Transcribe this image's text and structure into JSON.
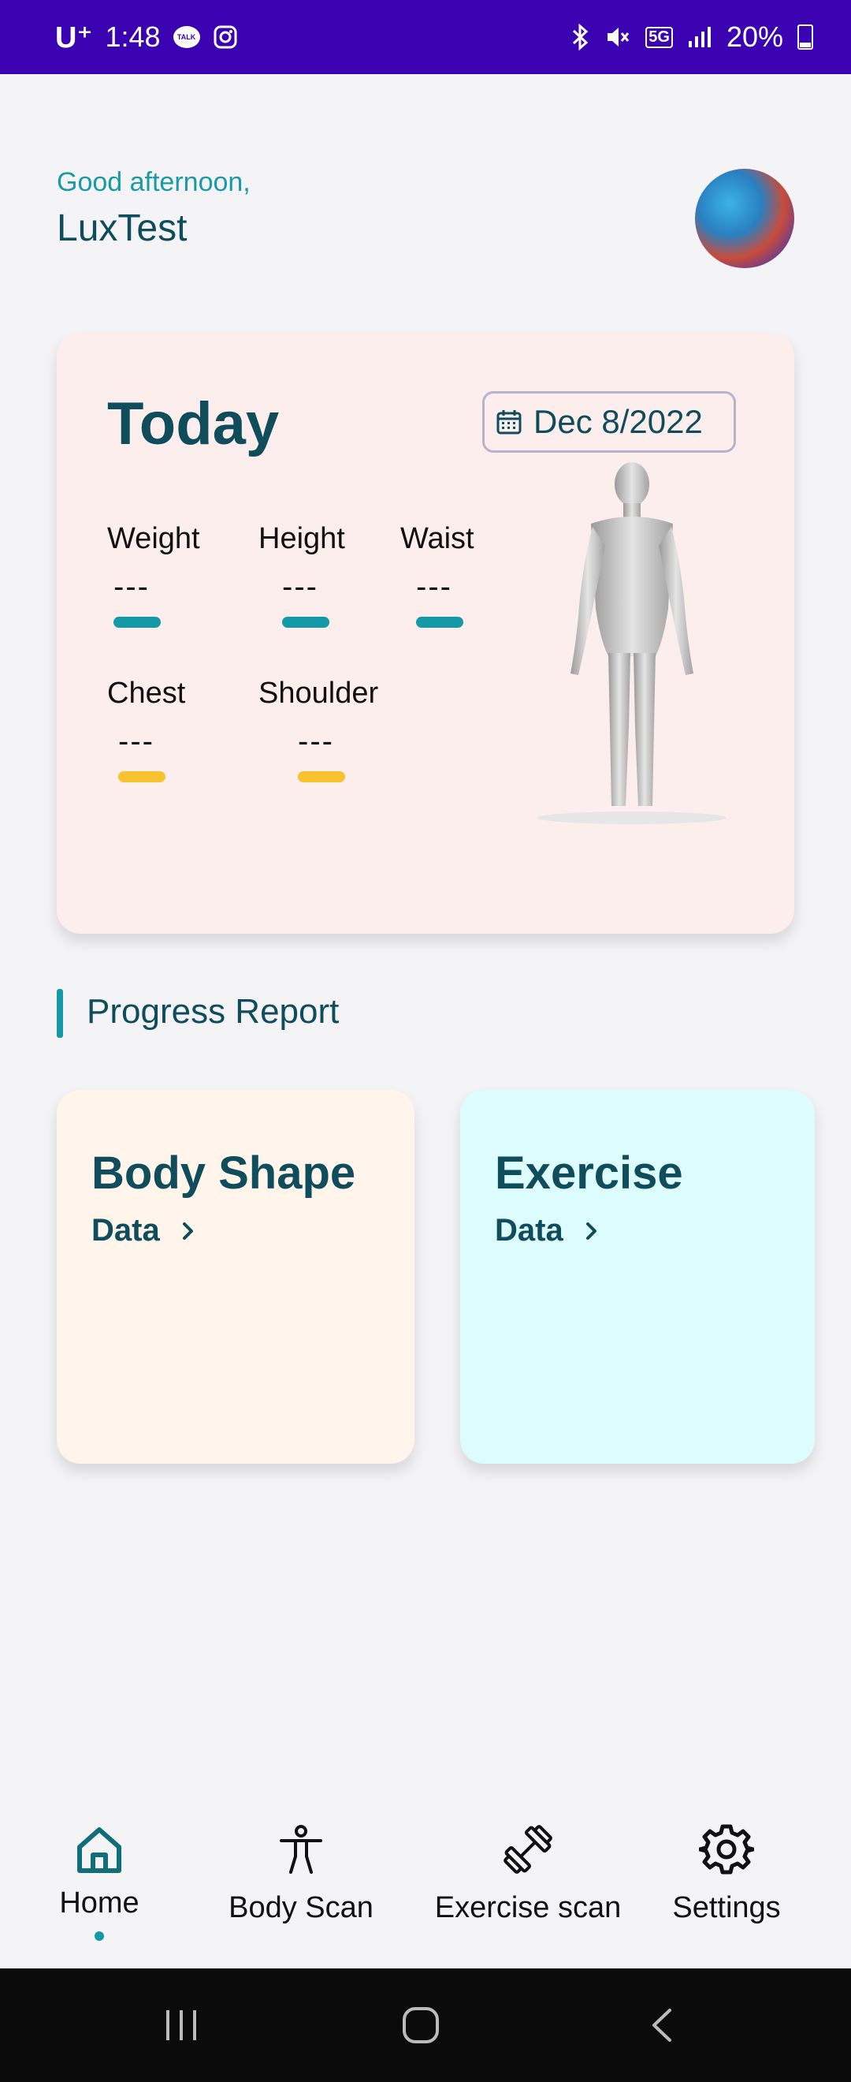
{
  "status_bar": {
    "carrier": "U⁺",
    "time": "1:48",
    "talk_label": "TALK",
    "network": "5G",
    "battery": "20%"
  },
  "greeting": {
    "salutation": "Good afternoon,",
    "username": "LuxTest"
  },
  "today": {
    "title": "Today",
    "date": "Dec 8/2022",
    "metrics_row1": [
      {
        "label": "Weight",
        "value": "---",
        "color": "#1599a6"
      },
      {
        "label": "Height",
        "value": "---",
        "color": "#1599a6"
      },
      {
        "label": "Waist",
        "value": "---",
        "color": "#1599a6"
      }
    ],
    "metrics_row2": [
      {
        "label": "Chest",
        "value": "---",
        "color": "#f7c32f"
      },
      {
        "label": "Shoulder",
        "value": "---",
        "color": "#f7c32f"
      }
    ]
  },
  "progress_report": {
    "title": "Progress Report",
    "cards": [
      {
        "title": "Body Shape",
        "link": "Data"
      },
      {
        "title": "Exercise",
        "link": "Data"
      }
    ]
  },
  "bottom_nav": {
    "items": [
      {
        "label": "Home",
        "icon": "home-icon",
        "active": true
      },
      {
        "label": "Body Scan",
        "icon": "body-scan-icon",
        "active": false
      },
      {
        "label": "Exercise scan",
        "icon": "dumbbell-icon",
        "active": false
      },
      {
        "label": "Settings",
        "icon": "gear-icon",
        "active": false
      }
    ]
  },
  "colors": {
    "status_bar": "#3a02b0",
    "accent_teal": "#1599a6",
    "accent_yellow": "#f7c32f",
    "text_dark": "#0f4c5c",
    "today_card_bg": "#fdeeee",
    "body_shape_bg": "#fff5ea",
    "exercise_bg": "#ddfcfd"
  }
}
